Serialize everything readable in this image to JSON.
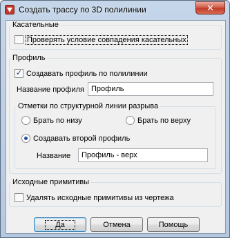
{
  "window": {
    "title": "Создать трассу по 3D полилинии",
    "close_label": "✕"
  },
  "tangent_group": {
    "title": "Касательные",
    "check_tangent": {
      "label": "Проверять условие совпадения касательных",
      "checked": false
    }
  },
  "profile_group": {
    "title": "Профиль",
    "create_profile": {
      "label": "Создавать профиль по полилинии",
      "checked": true
    },
    "profile_name_label": "Название профиля",
    "profile_name_value": "Профиль",
    "marks_group": {
      "title": "Отметки по структурной линии разрыва",
      "radio_bottom": {
        "label": "Брать по низу",
        "selected": false
      },
      "radio_top": {
        "label": "Брать по верху",
        "selected": false
      },
      "radio_second": {
        "label": "Создавать второй профиль",
        "selected": true
      },
      "name_label": "Название",
      "name_value": "Профиль - верх"
    }
  },
  "source_group": {
    "title": "Исходные примитивы",
    "delete_source": {
      "label": "Удалять исходные примитивы из чертежа",
      "checked": false
    }
  },
  "buttons": {
    "ok": "Да",
    "cancel": "Отмена",
    "help": "Помощь"
  }
}
